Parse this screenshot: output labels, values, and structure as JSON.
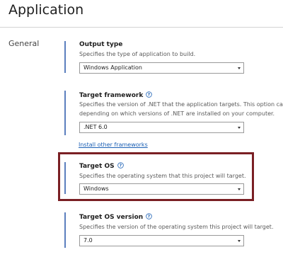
{
  "page": {
    "title": "Application"
  },
  "section": {
    "label": "General"
  },
  "output_type": {
    "heading": "Output type",
    "description": "Specifies the type of application to build.",
    "value": "Windows Application"
  },
  "target_framework": {
    "heading": "Target framework",
    "description_line1": "Specifies the version of .NET that the application targets. This option ca",
    "description_line2": "depending on which versions of .NET are installed on your computer.",
    "value": ".NET 6.0",
    "install_link": "Install other frameworks"
  },
  "target_os": {
    "heading": "Target OS",
    "description": "Specifies the operating system that this project will target.",
    "value": "Windows"
  },
  "target_os_version": {
    "heading": "Target OS version",
    "description": "Specifies the version of the operating system this project will target.",
    "value": "7.0"
  },
  "colors": {
    "accent_bar": "#5b7fbe",
    "link": "#1a5fb4",
    "highlight_border": "#7a1f24"
  },
  "icons": {
    "help": "help-circle-icon",
    "dropdown": "chevron-down-icon"
  }
}
